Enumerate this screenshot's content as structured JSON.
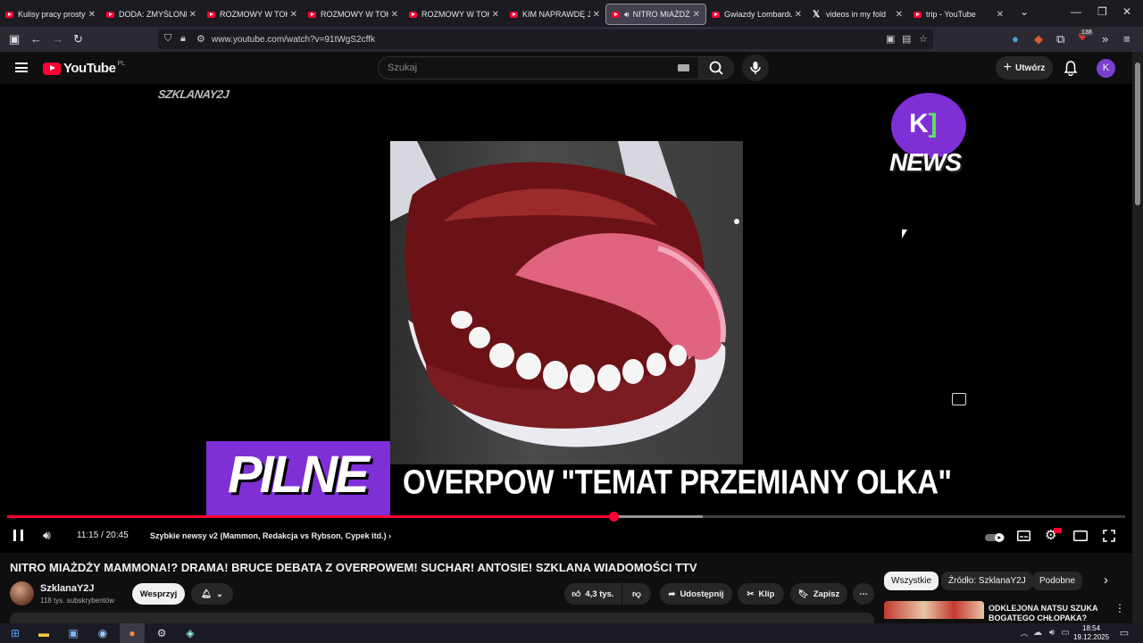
{
  "browser": {
    "tabs": [
      {
        "title": "Kulisy pracy prostytu",
        "icon": "youtube-icon"
      },
      {
        "title": "DODA: ZMYŚLONE ZI",
        "icon": "youtube-icon"
      },
      {
        "title": "ROZMOWY W TOKU",
        "icon": "youtube-icon"
      },
      {
        "title": "ROZMOWY W TOKU",
        "icon": "youtube-icon"
      },
      {
        "title": "ROZMOWY W TOKU",
        "icon": "youtube-icon"
      },
      {
        "title": "KIM NAPRAWDĘ JEST",
        "icon": "youtube-icon"
      },
      {
        "title": "NITRO MIAŻDŻY",
        "icon": "youtube-icon",
        "active": true,
        "playing": true
      },
      {
        "title": "Gwiazdy Lombardu: N",
        "icon": "youtube-icon"
      },
      {
        "title": "videos in my fold",
        "icon": "x-icon"
      },
      {
        "title": "trip - YouTube",
        "icon": "youtube-icon"
      }
    ],
    "url": "www.youtube.com/watch?v=91tWgS2cffk",
    "extension_badge": "138"
  },
  "youtube": {
    "logo_text": "YouTube",
    "country_code": "PL",
    "search_placeholder": "Szukaj",
    "create_label": "Utwórz",
    "avatar_letter": "K"
  },
  "video": {
    "watermark": "SZKLANAY2J",
    "news_logo_text": "NEWS",
    "badge_text": "PILNE",
    "overlay_headline": "OVERPOW \"TEMAT PRZEMIANY OLKA\"",
    "current_time": "11:15",
    "duration": "20:45",
    "time_display": "11:15 / 20:45",
    "progress_fraction": 0.542,
    "chapter": "Szybkie newsy v2 (Mammon, Redakcja vs Rybson, Cypek itd.)",
    "title": "NITRO MIAŻDŻY MAMMONA!? DRAMA! BRUCE DEBATA Z OVERPOWEM! SUCHAR! ANTOSIE! SZKLANA WIADOMOŚCI TTV"
  },
  "channel": {
    "name": "SzklanaY2J",
    "subscribers": "118 tys. subskrybentów",
    "support_label": "Wesprzyj"
  },
  "actions": {
    "likes": "4,3 tys.",
    "share_label": "Udostępnij",
    "clip_label": "Klip",
    "save_label": "Zapisz"
  },
  "chips": [
    "Wszystkie",
    "Źródło: SzklanaY2J",
    "Podobne"
  ],
  "recommended": {
    "title": "ODKLEJONA NATSU SZUKA BOGATEGO CHŁOPAKA?"
  },
  "taskbar": {
    "time": "18:54",
    "date": "19.12.2025"
  }
}
